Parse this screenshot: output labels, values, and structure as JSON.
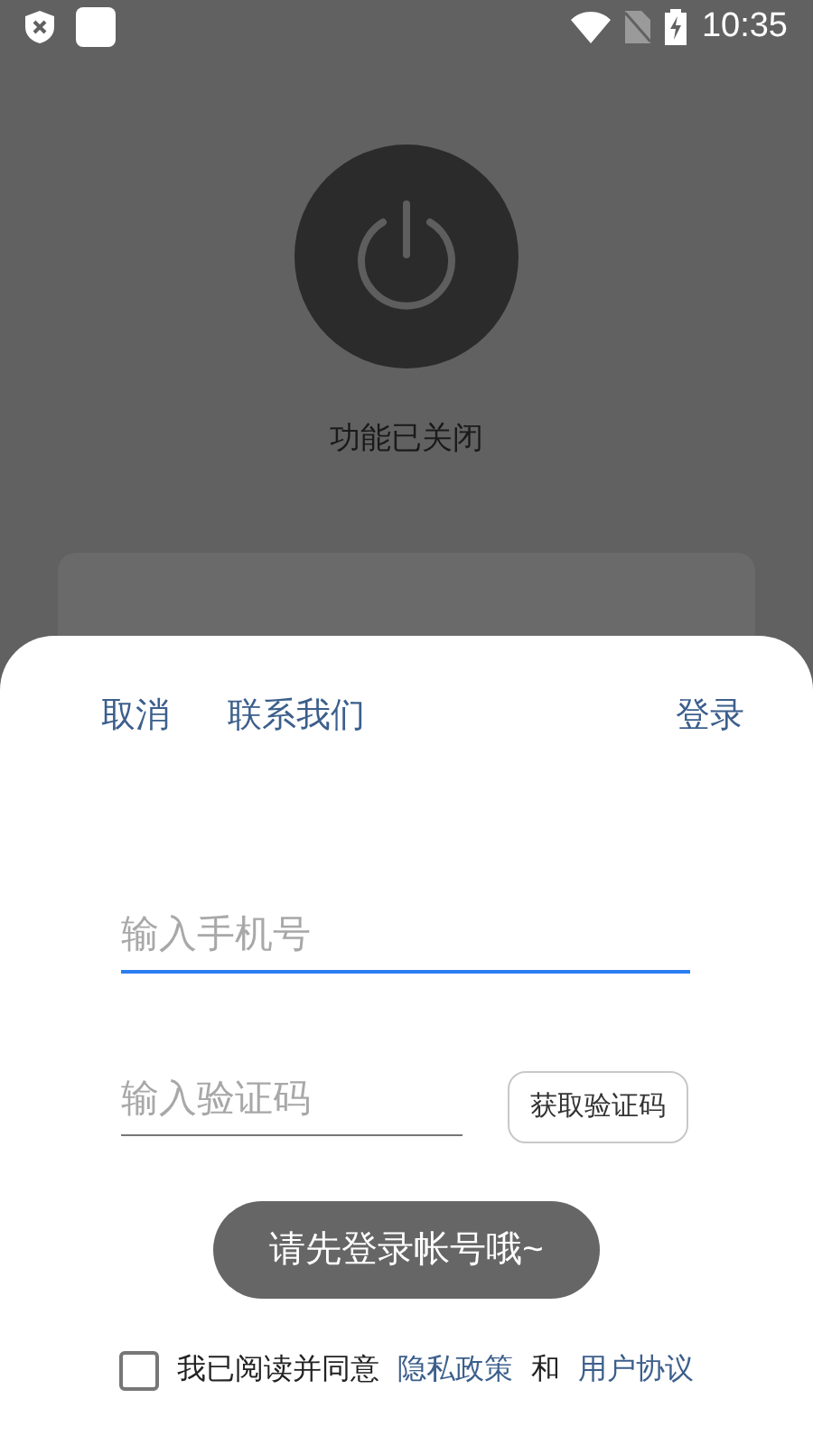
{
  "status_bar": {
    "time": "10:35"
  },
  "screen": {
    "status_text": "功能已关闭"
  },
  "sheet": {
    "cancel": "取消",
    "contact": "联系我们",
    "login": "登录",
    "phone_field": {
      "placeholder": "输入手机号",
      "focused": true
    },
    "code_field": {
      "placeholder": "输入验证码",
      "focused": false
    },
    "get_code_button": "获取验证码",
    "agreement": {
      "checked": false,
      "text": "我已阅读并同意",
      "privacy_link": "隐私政策",
      "and": "和",
      "terms_link": "用户协议"
    }
  },
  "toast": "请先登录帐号哦~"
}
